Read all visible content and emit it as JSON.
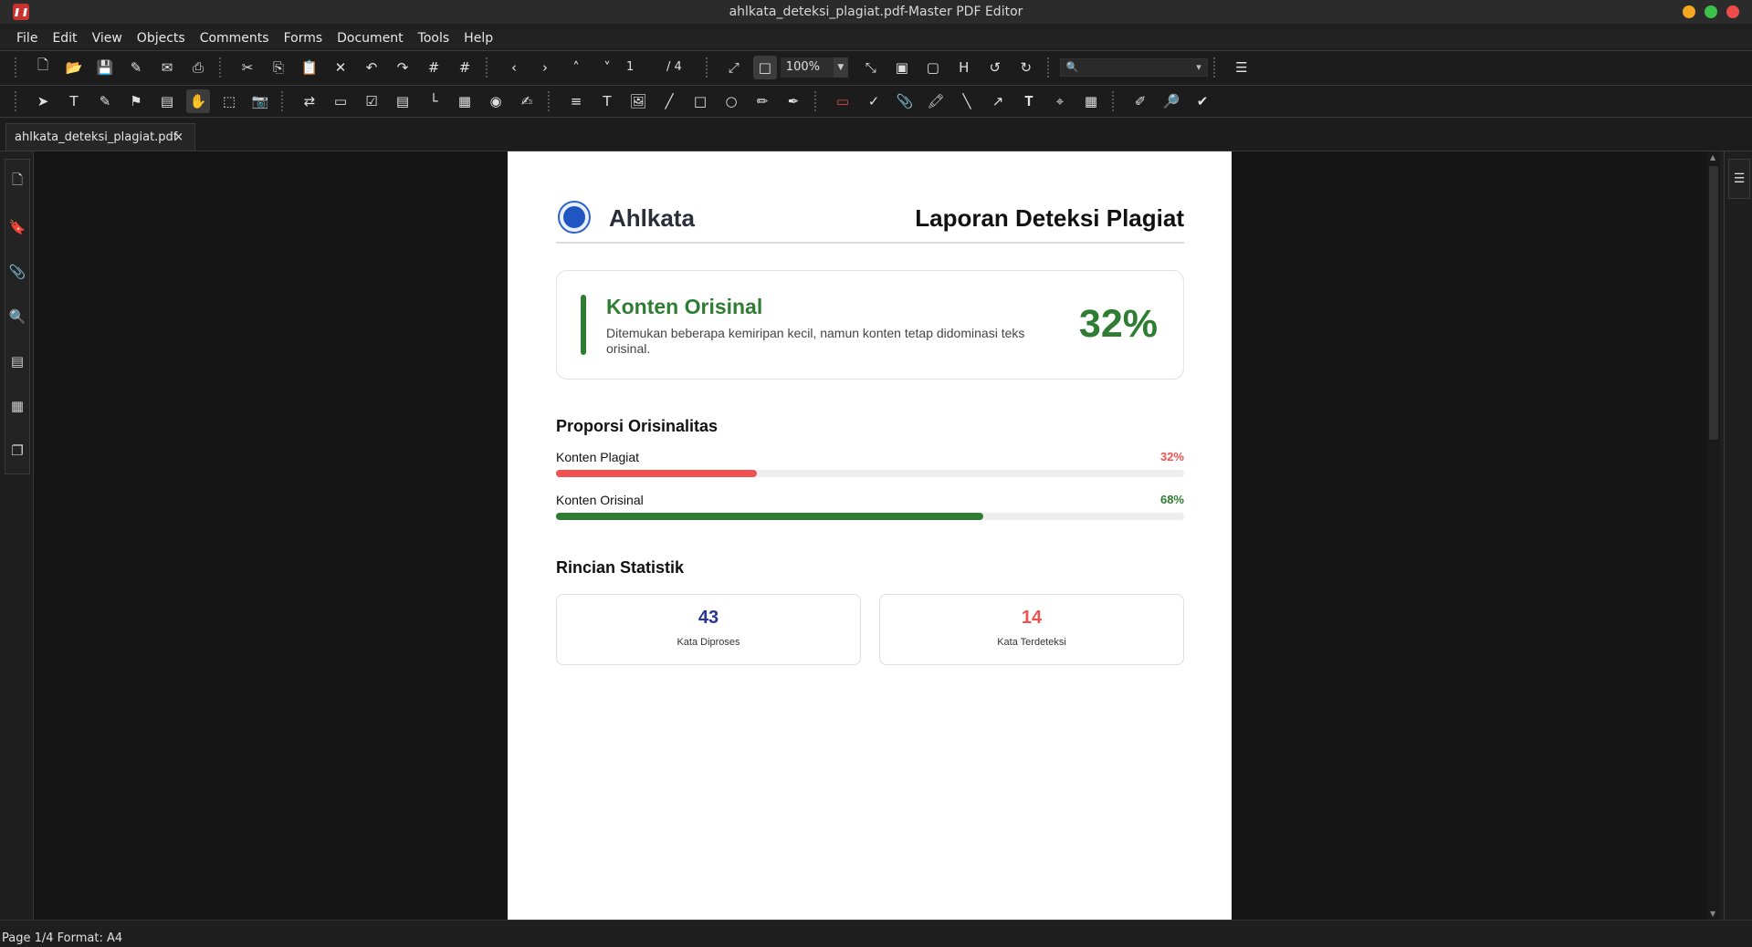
{
  "window": {
    "title": "ahlkata_deteksi_plagiat.pdf-Master PDF Editor",
    "controls": [
      {
        "name": "minimize",
        "color": "#f5a623"
      },
      {
        "name": "maximize",
        "color": "#3cc24a"
      },
      {
        "name": "close",
        "color": "#ee4b4b"
      }
    ]
  },
  "menu": [
    "File",
    "Edit",
    "View",
    "Objects",
    "Comments",
    "Forms",
    "Document",
    "Tools",
    "Help"
  ],
  "toolbar": {
    "page_current": "1",
    "page_total": "/ 4",
    "zoom": "100%"
  },
  "tab": {
    "label": "ahlkata_deteksi_plagiat.pdf",
    "close": "×"
  },
  "status": {
    "text": "Page 1/4 Format: A4"
  },
  "document": {
    "brand": "Ahlkata",
    "report_title": "Laporan Deteksi Plagiat",
    "result": {
      "title": "Konten Orisinal",
      "description": "Ditemukan beberapa kemiripan kecil, namun konten tetap didominasi teks orisinal.",
      "percent": "32%",
      "color": "#2e7d32"
    },
    "proportion": {
      "title": "Proporsi Orisinalitas",
      "bars": [
        {
          "label": "Konten Plagiat",
          "value_text": "32%",
          "value": 32,
          "color": "#f05252"
        },
        {
          "label": "Konten Orisinal",
          "value_text": "68%",
          "value": 68,
          "color": "#2e7d32"
        }
      ]
    },
    "statistics": {
      "title": "Rincian Statistik",
      "cards": [
        {
          "number": "43",
          "label": "Kata Diproses",
          "color": "#283593"
        },
        {
          "number": "14",
          "label": "Kata Terdeteksi",
          "color": "#f05252"
        }
      ]
    }
  }
}
